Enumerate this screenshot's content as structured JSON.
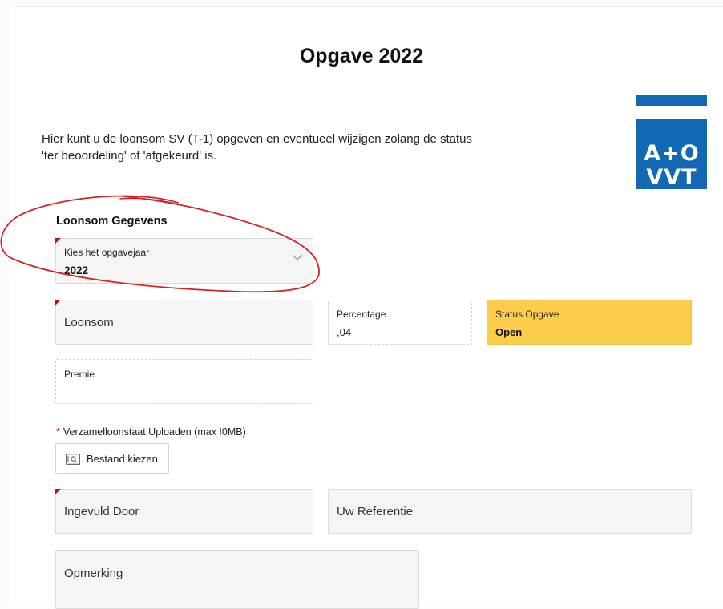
{
  "page": {
    "title": "Opgave 2022",
    "intro_line1": "Hier kunt u de loonsom SV (T-1) opgeven en eventueel wijzigen zolang de status",
    "intro_line2": "'ter beoordeling' of 'afgekeurd' is."
  },
  "logo": {
    "line1": "A+O",
    "line2": "VVT",
    "color": "#1268b3"
  },
  "section": {
    "title": "Loonsom Gegevens"
  },
  "fields": {
    "year": {
      "label": "Kies het opgavejaar",
      "value": "2022"
    },
    "loonsom": {
      "placeholder": "Loonsom"
    },
    "percentage": {
      "label": "Percentage",
      "value": ",04"
    },
    "status": {
      "label": "Status Opgave",
      "value": "Open",
      "color": "#fbcd4a"
    },
    "premie": {
      "label": "Premie"
    },
    "upload": {
      "label": "Verzamelloonstaat Uploaden (max !0MB)",
      "required_marker": "*",
      "button_label": "Bestand kiezen"
    },
    "ingevuld_door": {
      "placeholder": "Ingevuld Door"
    },
    "referentie": {
      "placeholder": "Uw Referentie"
    },
    "opmerking": {
      "placeholder": "Opmerking"
    }
  },
  "annotation": {
    "color": "#d4242b"
  },
  "icons": {
    "year_select": "chevron-down-icon",
    "upload": "file-browse-icon"
  }
}
